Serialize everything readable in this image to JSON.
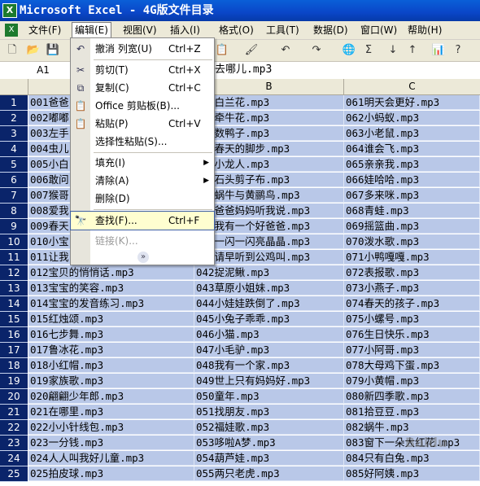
{
  "window": {
    "title": "Microsoft Excel - 4G版文件目录",
    "app_icon_letter": "X"
  },
  "menubar": {
    "items": [
      {
        "label": "文件(F)"
      },
      {
        "label": "编辑(E)",
        "active": true
      },
      {
        "label": "视图(V)"
      },
      {
        "label": "插入(I)"
      },
      {
        "label": "格式(O)"
      },
      {
        "label": "工具(T)"
      },
      {
        "label": "数据(D)"
      },
      {
        "label": "窗口(W)"
      },
      {
        "label": "帮助(H)"
      }
    ]
  },
  "toolbar": {
    "icons": [
      "new-icon",
      "open-icon",
      "save-icon",
      "print-icon",
      "preview-icon",
      "paste-icon",
      "format-painter-icon",
      "undo-icon",
      "redo-icon",
      "hyperlink-icon",
      "autosum-icon",
      "sort-asc-icon",
      "sort-desc-icon",
      "chart-icon",
      "help-icon"
    ]
  },
  "formula": {
    "name_box": "A1",
    "content": "去哪儿.mp3"
  },
  "columns": {
    "b": "B",
    "c": "C"
  },
  "rows": [
    {
      "n": "1",
      "a": "001爸爸",
      "b": "031白兰花.mp3",
      "c": "061明天会更好.mp3"
    },
    {
      "n": "2",
      "a": "002嘟嘟",
      "b": "032牵牛花.mp3",
      "c": "062小蚂蚁.mp3"
    },
    {
      "n": "3",
      "a": "003左手",
      "b": "033数鸭子.mp3",
      "c": "063小老鼠.mp3"
    },
    {
      "n": "4",
      "a": "004虫儿",
      "b": "034春天的脚步.mp3",
      "c": "064谁会飞.mp3"
    },
    {
      "n": "5",
      "a": "005小白",
      "b": "035小龙人.mp3",
      "c": "065亲亲我.mp3"
    },
    {
      "n": "6",
      "a": "006敢问",
      "b": "036石头剪子布.mp3",
      "c": "066娃哈哈.mp3"
    },
    {
      "n": "7",
      "a": "007猴哥",
      "b": "037蜗牛与黄鹂鸟.mp3",
      "c": "067多来咪.mp3"
    },
    {
      "n": "8",
      "a": "008爱我",
      "b": "038爸爸妈妈听我说.mp3",
      "c": "068青蛙.mp3"
    },
    {
      "n": "9",
      "a": "009春天",
      "b": "039我有一个好爸爸.mp3",
      "c": "069摇篮曲.mp3"
    },
    {
      "n": "10",
      "a": "010小宝",
      "b": "040一闪一闪亮晶晶.mp3",
      "c": "070泼水歌.mp3"
    },
    {
      "n": "11",
      "a": "011让我",
      "b": "041请早听到公鸡叫.mp3",
      "c": "071小鸭嘎嘎.mp3"
    },
    {
      "n": "12",
      "a": "012宝贝的悄悄话.mp3",
      "b": "042捉泥鳅.mp3",
      "c": "072表报歌.mp3"
    },
    {
      "n": "13",
      "a": "013宝宝的笑容.mp3",
      "b": "043草原小姐妹.mp3",
      "c": "073小燕子.mp3"
    },
    {
      "n": "14",
      "a": "014宝宝的发音练习.mp3",
      "b": "044小娃娃跌倒了.mp3",
      "c": "074春天的孩子.mp3"
    },
    {
      "n": "15",
      "a": "015红烛颂.mp3",
      "b": "045小兔子乖乖.mp3",
      "c": "075小螺号.mp3"
    },
    {
      "n": "16",
      "a": "016七步舞.mp3",
      "b": "046小猫.mp3",
      "c": "076生日快乐.mp3"
    },
    {
      "n": "17",
      "a": "017鲁冰花.mp3",
      "b": "047小毛驴.mp3",
      "c": "077小阿哥.mp3"
    },
    {
      "n": "18",
      "a": "018小红帽.mp3",
      "b": "048我有一个家.mp3",
      "c": "078大母鸡下蛋.mp3"
    },
    {
      "n": "19",
      "a": "019家族歌.mp3",
      "b": "049世上只有妈妈好.mp3",
      "c": "079小黄帽.mp3"
    },
    {
      "n": "20",
      "a": "020翩翩少年郎.mp3",
      "b": "050童年.mp3",
      "c": "080新四季歌.mp3"
    },
    {
      "n": "21",
      "a": "021在哪里.mp3",
      "b": "051找朋友.mp3",
      "c": "081拾豆豆.mp3"
    },
    {
      "n": "22",
      "a": "022小小针线包.mp3",
      "b": "052福娃歌.mp3",
      "c": "082蜗牛.mp3"
    },
    {
      "n": "23",
      "a": "023一分钱.mp3",
      "b": "053哆啦A梦.mp3",
      "c": "083窗下一朵大红花.mp3"
    },
    {
      "n": "24",
      "a": "024人人叫我好儿童.mp3",
      "b": "054葫芦娃.mp3",
      "c": "084只有白兔.mp3"
    },
    {
      "n": "25",
      "a": "025拍皮球.mp3",
      "b": "055两只老虎.mp3",
      "c": "085好阿姨.mp3"
    }
  ],
  "edit_menu": {
    "items": [
      {
        "icon": "undo-icon",
        "label": "撤消 列宽(U)",
        "shortcut": "Ctrl+Z"
      },
      {
        "icon": "cut-icon",
        "label": "剪切(T)",
        "shortcut": "Ctrl+X"
      },
      {
        "icon": "copy-icon",
        "label": "复制(C)",
        "shortcut": "Ctrl+C"
      },
      {
        "icon": "clipboard-icon",
        "label": "Office 剪贴板(B)...",
        "shortcut": ""
      },
      {
        "icon": "paste-icon",
        "label": "粘贴(P)",
        "shortcut": "Ctrl+V"
      },
      {
        "icon": "",
        "label": "选择性粘贴(S)...",
        "shortcut": ""
      },
      {
        "icon": "",
        "label": "填充(I)",
        "shortcut": "",
        "submenu": true
      },
      {
        "icon": "",
        "label": "清除(A)",
        "shortcut": "",
        "submenu": true
      },
      {
        "icon": "",
        "label": "删除(D)",
        "shortcut": ""
      },
      {
        "icon": "binoculars-icon",
        "label": "查找(F)...",
        "shortcut": "Ctrl+F",
        "selected": true
      },
      {
        "icon": "",
        "label": "链接(K)...",
        "shortcut": "",
        "disabled": true
      }
    ],
    "expand_glyph": "»"
  },
  "watermark": {
    "text": "Baidu"
  }
}
